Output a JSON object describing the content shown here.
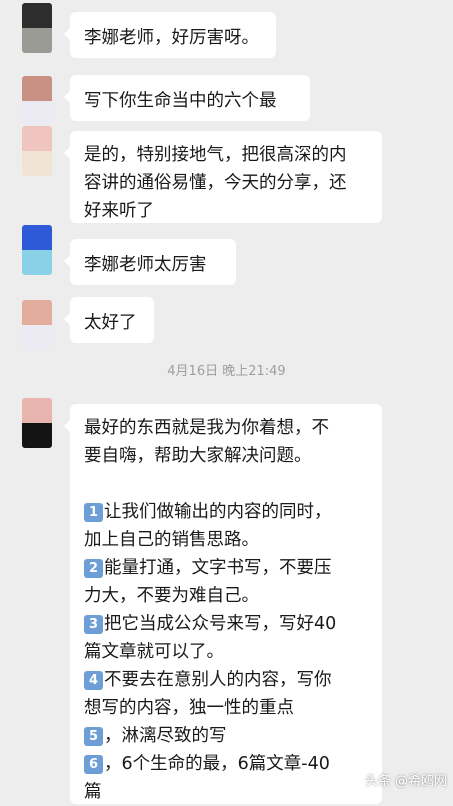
{
  "messages": [
    {
      "text": "李娜老师，好厉害呀。",
      "avatar_colors": [
        "#2d2d2d",
        "#9a9a94"
      ]
    },
    {
      "text": "写下你生命当中的六个最",
      "avatar_colors": [
        "#c99184",
        "#eceaf2"
      ]
    },
    {
      "lines": [
        "是的，特别接地气，把很高深的内",
        "容讲的通俗易懂，今天的分享，还",
        "好来听了"
      ],
      "avatar_colors": [
        "#f1c5bf",
        "#f1e4d5"
      ]
    },
    {
      "text": "李娜老师太厉害",
      "avatar_colors": [
        "#2e5ad8",
        "#8ad0e6"
      ]
    },
    {
      "text": "太好了",
      "avatar_colors": [
        "#e3ad9d",
        "#eceaf2"
      ]
    }
  ],
  "timestamp": "4月16日 晚上21:49",
  "last_message": {
    "avatar_colors": [
      "#e7b5ad",
      "#141414"
    ],
    "intro": [
      "最好的东西就是我为你着想，不",
      "要自嗨，帮助大家解决问题。"
    ],
    "items": [
      {
        "num": "1",
        "lines": [
          "让我们做输出的内容的同时，",
          "加上自己的销售思路。"
        ]
      },
      {
        "num": "2",
        "lines": [
          "能量打通，文字书写，不要压",
          "力大，不要为难自己。"
        ]
      },
      {
        "num": "3",
        "lines": [
          "把它当成公众号来写，写好40",
          "篇文章就可以了。"
        ]
      },
      {
        "num": "4",
        "lines": [
          "不要去在意别人的内容，写你",
          "想写的内容，独一性的重点"
        ]
      },
      {
        "num": "5",
        "lines": [
          "，淋漓尽致的写"
        ]
      },
      {
        "num": "6",
        "lines": [
          "，6个生命的最，6篇文章-40",
          "篇"
        ]
      }
    ]
  },
  "watermark": {
    "text": "头条 @希鸥网"
  }
}
